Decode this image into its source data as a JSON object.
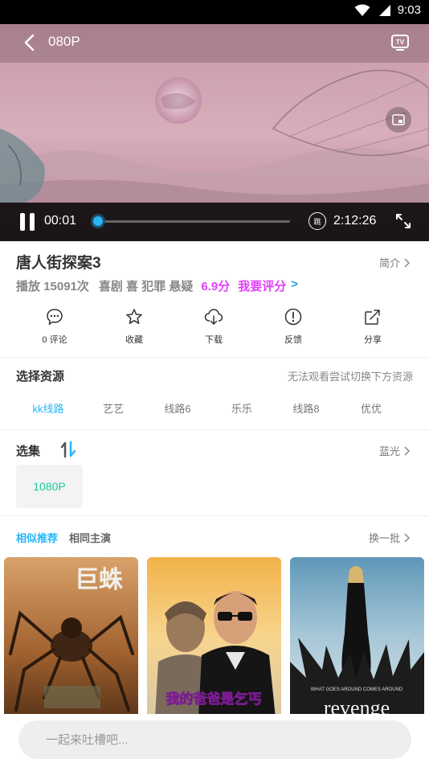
{
  "status_bar": {
    "time": "9:03"
  },
  "player": {
    "title": "080P",
    "current_time": "00:01",
    "total_time": "2:12:26",
    "progress": 0.0,
    "skip_label": "跳"
  },
  "movie": {
    "title": "唐人街探案3",
    "intro_label": "简介",
    "play_count": "播放 15091次",
    "genres": "喜剧 喜 犯罪 悬疑",
    "score": "6.9分",
    "rate_label": "我要评分",
    "rate_chevron": ">"
  },
  "actions": [
    {
      "label": "0 评论",
      "icon": "comment-icon"
    },
    {
      "label": "收藏",
      "icon": "star-icon"
    },
    {
      "label": "下载",
      "icon": "cloud-download-icon"
    },
    {
      "label": "反馈",
      "icon": "exclamation-icon"
    },
    {
      "label": "分享",
      "icon": "share-icon"
    }
  ],
  "sources": {
    "title": "选择资源",
    "note": "无法观看尝试切换下方资源",
    "items": [
      "kk线路",
      "艺艺",
      "线路6",
      "乐乐",
      "线路8",
      "优优"
    ],
    "active_index": 0
  },
  "episodes": {
    "title": "选集",
    "quality_link": "蓝光",
    "items": [
      "1080P"
    ]
  },
  "recommend": {
    "tabs": [
      "相似推荐",
      "相同主演"
    ],
    "refresh_label": "换一批"
  },
  "posters": {
    "p1_text": "巨蛛",
    "p2_text": "我的爸爸是乞丐",
    "p3_text": "revenge",
    "p3_tagline": "WHAT GOES AROUND COMES AROUND"
  },
  "comment": {
    "placeholder": "一起来吐槽吧..."
  },
  "colors": {
    "accent": "#29b6f6",
    "score": "#e040fb",
    "green": "#1fc99c"
  }
}
